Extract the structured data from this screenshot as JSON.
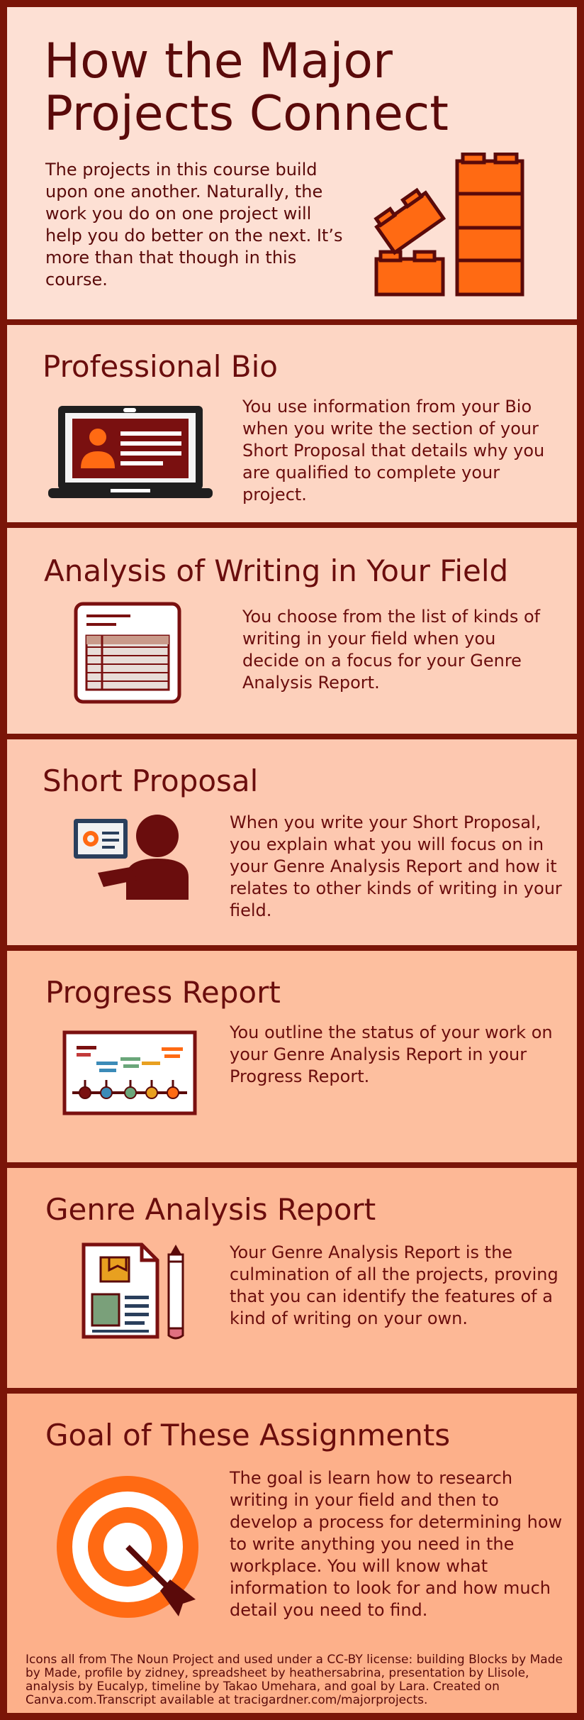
{
  "header": {
    "title_line1": "How the Major",
    "title_line2": "Projects Connect",
    "intro": "The projects in this course build upon one another. Naturally, the work you do on one project will help you do better on the next. It’s more than that though in this course."
  },
  "sections": [
    {
      "title": "Professional Bio",
      "text": "You use information from your Bio when you write the section of your Short Proposal that details why you are qualified to complete your project.",
      "icon": "laptop-profile-icon"
    },
    {
      "title": "Analysis of Writing in Your Field",
      "text": "You choose from the list of kinds of writing in your field when you decide on a focus for your Genre Analysis Report.",
      "icon": "spreadsheet-icon"
    },
    {
      "title": "Short Proposal",
      "text": "When you write your Short Proposal, you explain what you will focus on in your Genre Analysis Report and how it relates to other kinds of writing in your field.",
      "icon": "presentation-icon"
    },
    {
      "title": "Progress Report",
      "text": "You outline the status of your work on your Genre Analysis Report in your Progress Report.",
      "icon": "timeline-icon"
    },
    {
      "title": "Genre Analysis Report",
      "text": "Your Genre Analysis Report is the culmination of all the projects, proving that you can identify the features of a kind of writing on your own.",
      "icon": "analysis-document-icon"
    },
    {
      "title": "Goal of These Assignments",
      "text": "The goal is learn how to research writing in your field and then to develop a process for determining how to write anything you need in the workplace. You will know what information to look for and how much detail you need to find.",
      "icon": "target-icon"
    }
  ],
  "footer": "Icons all from The Noun Project and used under a CC-BY license: building Blocks by Made by Made, profile by zidney, spreadsheet by heathersabrina, presentation by Llisole, analysis by Eucalyp, timeline by Takao Umehara, and goal by Lara. Created on Canva.com.Transcript available at tracigardner.com/majorprojects.",
  "colors": {
    "border": "#7a1508",
    "text": "#5a0a0a",
    "accent_orange": "#ff6a13"
  }
}
